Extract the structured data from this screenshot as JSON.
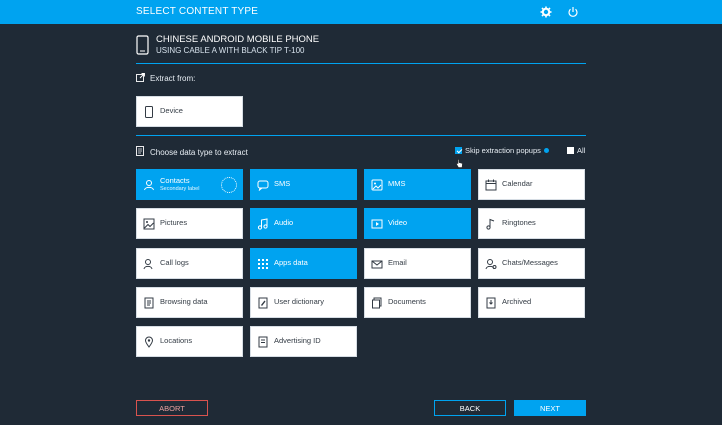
{
  "header": {
    "title": "SELECT CONTENT TYPE"
  },
  "device": {
    "name": "CHINESE ANDROID MOBILE PHONE",
    "connection": "USING CABLE A WITH BLACK TIP T-100"
  },
  "extract_from": {
    "label": "Extract from:",
    "source": "Device"
  },
  "choose": {
    "label": "Choose data type to extract"
  },
  "options": {
    "skip_popups": "Skip extraction popups",
    "all": "All"
  },
  "content_types": [
    {
      "label": "Contacts",
      "secondary": "Secondary label",
      "icon": "contacts-icon",
      "selected": true
    },
    {
      "label": "SMS",
      "icon": "sms-icon",
      "selected": true
    },
    {
      "label": "MMS",
      "icon": "mms-icon",
      "selected": true
    },
    {
      "label": "Calendar",
      "icon": "calendar-icon",
      "selected": false
    },
    {
      "label": "Pictures",
      "icon": "pictures-icon",
      "selected": false
    },
    {
      "label": "Audio",
      "icon": "audio-icon",
      "selected": true
    },
    {
      "label": "Video",
      "icon": "video-icon",
      "selected": true
    },
    {
      "label": "Ringtones",
      "icon": "ringtones-icon",
      "selected": false
    },
    {
      "label": "Call logs",
      "icon": "call-logs-icon",
      "selected": false
    },
    {
      "label": "Apps data",
      "icon": "apps-data-icon",
      "selected": true
    },
    {
      "label": "Email",
      "icon": "email-icon",
      "selected": false
    },
    {
      "label": "Chats/Messages",
      "icon": "chats-icon",
      "selected": false
    },
    {
      "label": "Browsing data",
      "icon": "browsing-data-icon",
      "selected": false
    },
    {
      "label": "User dictionary",
      "icon": "user-dictionary-icon",
      "selected": false
    },
    {
      "label": "Documents",
      "icon": "documents-icon",
      "selected": false
    },
    {
      "label": "Archived",
      "icon": "archived-icon",
      "selected": false
    },
    {
      "label": "Locations",
      "icon": "locations-icon",
      "selected": false
    },
    {
      "label": "Advertising ID",
      "icon": "advertising-id-icon",
      "selected": false
    }
  ],
  "footer": {
    "abort": "ABORT",
    "back": "BACK",
    "next": "NEXT"
  },
  "colors": {
    "accent": "#00a3f0",
    "background": "#1f2a36",
    "abort": "#d9534f"
  }
}
